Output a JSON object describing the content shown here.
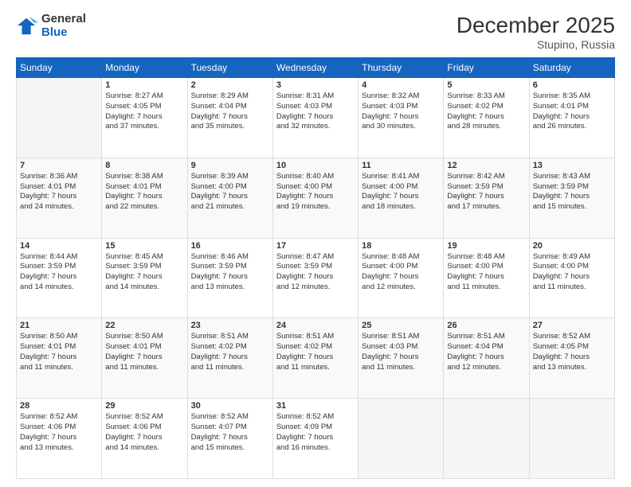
{
  "logo": {
    "general": "General",
    "blue": "Blue"
  },
  "header": {
    "month": "December 2025",
    "location": "Stupino, Russia"
  },
  "weekdays": [
    "Sunday",
    "Monday",
    "Tuesday",
    "Wednesday",
    "Thursday",
    "Friday",
    "Saturday"
  ],
  "weeks": [
    [
      {
        "day": "",
        "info": ""
      },
      {
        "day": "1",
        "info": "Sunrise: 8:27 AM\nSunset: 4:05 PM\nDaylight: 7 hours\nand 37 minutes."
      },
      {
        "day": "2",
        "info": "Sunrise: 8:29 AM\nSunset: 4:04 PM\nDaylight: 7 hours\nand 35 minutes."
      },
      {
        "day": "3",
        "info": "Sunrise: 8:31 AM\nSunset: 4:03 PM\nDaylight: 7 hours\nand 32 minutes."
      },
      {
        "day": "4",
        "info": "Sunrise: 8:32 AM\nSunset: 4:03 PM\nDaylight: 7 hours\nand 30 minutes."
      },
      {
        "day": "5",
        "info": "Sunrise: 8:33 AM\nSunset: 4:02 PM\nDaylight: 7 hours\nand 28 minutes."
      },
      {
        "day": "6",
        "info": "Sunrise: 8:35 AM\nSunset: 4:01 PM\nDaylight: 7 hours\nand 26 minutes."
      }
    ],
    [
      {
        "day": "7",
        "info": "Sunrise: 8:36 AM\nSunset: 4:01 PM\nDaylight: 7 hours\nand 24 minutes."
      },
      {
        "day": "8",
        "info": "Sunrise: 8:38 AM\nSunset: 4:01 PM\nDaylight: 7 hours\nand 22 minutes."
      },
      {
        "day": "9",
        "info": "Sunrise: 8:39 AM\nSunset: 4:00 PM\nDaylight: 7 hours\nand 21 minutes."
      },
      {
        "day": "10",
        "info": "Sunrise: 8:40 AM\nSunset: 4:00 PM\nDaylight: 7 hours\nand 19 minutes."
      },
      {
        "day": "11",
        "info": "Sunrise: 8:41 AM\nSunset: 4:00 PM\nDaylight: 7 hours\nand 18 minutes."
      },
      {
        "day": "12",
        "info": "Sunrise: 8:42 AM\nSunset: 3:59 PM\nDaylight: 7 hours\nand 17 minutes."
      },
      {
        "day": "13",
        "info": "Sunrise: 8:43 AM\nSunset: 3:59 PM\nDaylight: 7 hours\nand 15 minutes."
      }
    ],
    [
      {
        "day": "14",
        "info": "Sunrise: 8:44 AM\nSunset: 3:59 PM\nDaylight: 7 hours\nand 14 minutes."
      },
      {
        "day": "15",
        "info": "Sunrise: 8:45 AM\nSunset: 3:59 PM\nDaylight: 7 hours\nand 14 minutes."
      },
      {
        "day": "16",
        "info": "Sunrise: 8:46 AM\nSunset: 3:59 PM\nDaylight: 7 hours\nand 13 minutes."
      },
      {
        "day": "17",
        "info": "Sunrise: 8:47 AM\nSunset: 3:59 PM\nDaylight: 7 hours\nand 12 minutes."
      },
      {
        "day": "18",
        "info": "Sunrise: 8:48 AM\nSunset: 4:00 PM\nDaylight: 7 hours\nand 12 minutes."
      },
      {
        "day": "19",
        "info": "Sunrise: 8:48 AM\nSunset: 4:00 PM\nDaylight: 7 hours\nand 11 minutes."
      },
      {
        "day": "20",
        "info": "Sunrise: 8:49 AM\nSunset: 4:00 PM\nDaylight: 7 hours\nand 11 minutes."
      }
    ],
    [
      {
        "day": "21",
        "info": "Sunrise: 8:50 AM\nSunset: 4:01 PM\nDaylight: 7 hours\nand 11 minutes."
      },
      {
        "day": "22",
        "info": "Sunrise: 8:50 AM\nSunset: 4:01 PM\nDaylight: 7 hours\nand 11 minutes."
      },
      {
        "day": "23",
        "info": "Sunrise: 8:51 AM\nSunset: 4:02 PM\nDaylight: 7 hours\nand 11 minutes."
      },
      {
        "day": "24",
        "info": "Sunrise: 8:51 AM\nSunset: 4:02 PM\nDaylight: 7 hours\nand 11 minutes."
      },
      {
        "day": "25",
        "info": "Sunrise: 8:51 AM\nSunset: 4:03 PM\nDaylight: 7 hours\nand 11 minutes."
      },
      {
        "day": "26",
        "info": "Sunrise: 8:51 AM\nSunset: 4:04 PM\nDaylight: 7 hours\nand 12 minutes."
      },
      {
        "day": "27",
        "info": "Sunrise: 8:52 AM\nSunset: 4:05 PM\nDaylight: 7 hours\nand 13 minutes."
      }
    ],
    [
      {
        "day": "28",
        "info": "Sunrise: 8:52 AM\nSunset: 4:06 PM\nDaylight: 7 hours\nand 13 minutes."
      },
      {
        "day": "29",
        "info": "Sunrise: 8:52 AM\nSunset: 4:06 PM\nDaylight: 7 hours\nand 14 minutes."
      },
      {
        "day": "30",
        "info": "Sunrise: 8:52 AM\nSunset: 4:07 PM\nDaylight: 7 hours\nand 15 minutes."
      },
      {
        "day": "31",
        "info": "Sunrise: 8:52 AM\nSunset: 4:09 PM\nDaylight: 7 hours\nand 16 minutes."
      },
      {
        "day": "",
        "info": ""
      },
      {
        "day": "",
        "info": ""
      },
      {
        "day": "",
        "info": ""
      }
    ]
  ]
}
